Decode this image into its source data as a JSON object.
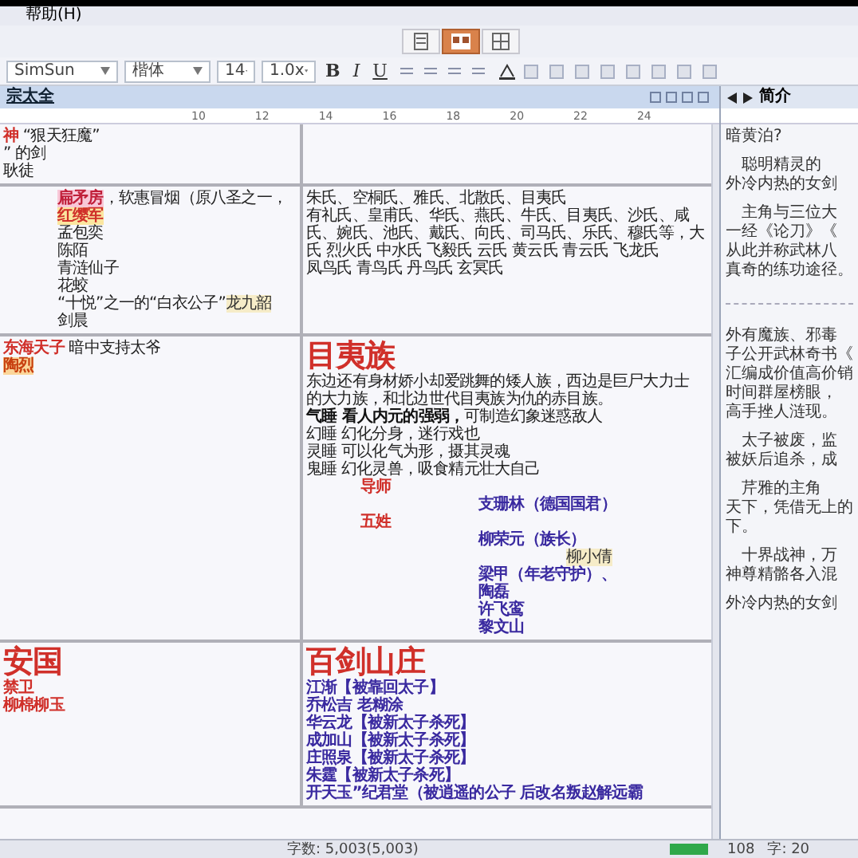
{
  "menu_bar": {
    "items": [
      "帮助(H)"
    ]
  },
  "view_buttons": [
    {
      "selected": false
    },
    {
      "selected": true
    },
    {
      "selected": false
    }
  ],
  "format_toolbar": {
    "font_name": "SimSun",
    "font_family": "楷体",
    "font_size": "14",
    "line_spacing": "1.0x",
    "style_buttons": [
      "B",
      "I",
      "U"
    ]
  },
  "document": {
    "title": "宗太全",
    "ruler_labels": [
      "10",
      "12",
      "14",
      "16",
      "18",
      "20",
      "22",
      "24"
    ],
    "rows": [
      {
        "cells": [
          [
            {
              "kind": "entry",
              "spans": [
                {
                  "text": "神",
                  "kind": "red"
                },
                {
                  "text": "    “狠天狂魔”",
                  "kind": "plain"
                }
              ]
            },
            {
              "kind": "entry",
              "spans": [
                {
                  "text": "”  的剑",
                  "kind": "plain"
                }
              ]
            },
            {
              "kind": "entry",
              "spans": [
                {
                  "text": "  耿徒",
                  "kind": "plain"
                }
              ]
            }
          ],
          []
        ]
      },
      {
        "cells": [
          [
            {
              "kind": "sub",
              "spans": [
                {
                  "text": "扁矛房",
                  "kind": "pink"
                },
                {
                  "text": "，软惠冒烟（原八圣之一，",
                  "kind": "plain"
                }
              ]
            },
            {
              "kind": "sub",
              "spans": [
                {
                  "text": "红缨军",
                  "kind": "yellow"
                }
              ]
            },
            {
              "kind": "sub",
              "spans": [
                {
                  "text": "孟包奕",
                  "kind": "plain"
                }
              ]
            },
            {
              "kind": "sub",
              "spans": [
                {
                  "text": "陈陌",
                  "kind": "plain"
                }
              ]
            },
            {
              "kind": "sub",
              "spans": [
                {
                  "text": "青涟仙子",
                  "kind": "plain"
                }
              ]
            },
            {
              "kind": "sub",
              "spans": [
                {
                  "text": "花蛟",
                  "kind": "plain"
                }
              ]
            },
            {
              "kind": "sub",
              "spans": [
                {
                  "text": "“十悦”之一的“白衣公子”",
                  "kind": "plain"
                },
                {
                  "text": "龙九韶",
                  "kind": "beige"
                }
              ]
            },
            {
              "kind": "sub",
              "spans": [
                {
                  "text": "剑晨",
                  "kind": "plain"
                }
              ]
            }
          ],
          [
            {
              "kind": "entry",
              "spans": [
                {
                  "text": "朱氏、空桐氏、雅氏、北散氏、目夷氏",
                  "kind": "plain"
                }
              ]
            },
            {
              "kind": "entry",
              "spans": [
                {
                  "text": "有礼氏、皇甫氏、华氏、燕氏、牛氏、目夷氏、沙氏、咸",
                  "kind": "plain"
                }
              ]
            },
            {
              "kind": "entry",
              "spans": [
                {
                  "text": "氏、婉氏、池氏、戴氏、向氏、司马氏、乐氏、穆氏等，大",
                  "kind": "plain"
                }
              ]
            },
            {
              "kind": "entry",
              "spans": [
                {
                  "text": "氏 烈火氏 中水氏 飞毅氏 云氏 黄云氏 青云氏 飞龙氏",
                  "kind": "plain"
                }
              ]
            },
            {
              "kind": "entry",
              "spans": [
                {
                  "text": "凤鸟氏 青鸟氏 丹鸟氏 玄冥氏",
                  "kind": "plain"
                }
              ]
            }
          ]
        ]
      },
      {
        "cells": [
          [
            {
              "kind": "entry",
              "spans": [
                {
                  "text": "东海天子",
                  "kind": "red"
                },
                {
                  "text": " 暗中支持太爷",
                  "kind": "plain"
                }
              ]
            },
            {
              "kind": "entry",
              "spans": [
                {
                  "text": "陶烈",
                  "kind": "orange"
                }
              ]
            }
          ],
          [
            {
              "kind": "entry",
              "spans": [
                {
                  "text": "目夷族",
                  "kind": "heading"
                }
              ]
            },
            {
              "kind": "entry",
              "spans": [
                {
                  "text": "东边还有身材娇小却爱跳舞的矮人族，西边是巨尸大力士",
                  "kind": "plain"
                }
              ]
            },
            {
              "kind": "entry",
              "spans": [
                {
                  "text": "的大力族，和北边世代目夷族为仇的赤目族。",
                  "kind": "plain"
                }
              ]
            },
            {
              "kind": "entry",
              "spans": [
                {
                  "text": "气睡 看人内元的强弱，",
                  "kind": "bold"
                },
                {
                  "text": "可制造幻象迷惑敌人",
                  "kind": "plain"
                }
              ]
            },
            {
              "kind": "entry",
              "spans": [
                {
                  "text": "幻睡 幻化分身，迷行戏也",
                  "kind": "plain"
                }
              ]
            },
            {
              "kind": "entry",
              "spans": [
                {
                  "text": "灵睡 可以化气为形，摄其灵魂",
                  "kind": "plain"
                }
              ]
            },
            {
              "kind": "entry",
              "spans": [
                {
                  "text": "鬼睡 幻化灵兽，吸食精元壮大自己",
                  "kind": "plain"
                }
              ]
            },
            {
              "kind": "sub",
              "spans": [
                {
                  "text": "导师",
                  "kind": "red"
                }
              ]
            },
            {
              "kind": "member",
              "spans": [
                {
                  "text": "支珊林（德国国君）",
                  "kind": "blue"
                }
              ]
            },
            {
              "kind": "sub",
              "spans": [
                {
                  "text": "五姓",
                  "kind": "red"
                }
              ]
            },
            {
              "kind": "member",
              "spans": [
                {
                  "text": "柳荣元（族长）",
                  "kind": "blue"
                }
              ]
            },
            {
              "kind": "aside",
              "spans": [
                {
                  "text": "柳小倩",
                  "kind": "beige"
                }
              ]
            },
            {
              "kind": "member",
              "spans": [
                {
                  "text": "梁甲（年老守护）、",
                  "kind": "blue"
                }
              ]
            },
            {
              "kind": "member",
              "spans": [
                {
                  "text": "陶磊",
                  "kind": "blue"
                }
              ]
            },
            {
              "kind": "member",
              "spans": [
                {
                  "text": "许飞鸾",
                  "kind": "blue"
                }
              ]
            },
            {
              "kind": "member",
              "spans": [
                {
                  "text": "黎文山",
                  "kind": "blue"
                }
              ]
            }
          ]
        ]
      },
      {
        "cells": [
          [
            {
              "kind": "entry",
              "spans": [
                {
                  "text": "安国",
                  "kind": "heading"
                }
              ]
            },
            {
              "kind": "entry",
              "spans": [
                {
                  "text": "禁卫",
                  "kind": "red"
                }
              ]
            },
            {
              "kind": "entry",
              "spans": [
                {
                  "text": "柳棉柳玉",
                  "kind": "red"
                }
              ]
            }
          ],
          [
            {
              "kind": "entry",
              "spans": [
                {
                  "text": "百剑山庄",
                  "kind": "heading"
                }
              ]
            },
            {
              "kind": "entry",
              "spans": [
                {
                  "text": "江渐【被靠回太子】",
                  "kind": "blue"
                }
              ]
            },
            {
              "kind": "entry",
              "spans": [
                {
                  "text": "乔松吉 老糊涂",
                  "kind": "blue"
                }
              ]
            },
            {
              "kind": "entry",
              "spans": [
                {
                  "text": "华云龙【被新太子杀死】",
                  "kind": "blue"
                }
              ]
            },
            {
              "kind": "entry",
              "spans": [
                {
                  "text": "成加山【被新太子杀死】",
                  "kind": "blue"
                }
              ]
            },
            {
              "kind": "entry",
              "spans": [
                {
                  "text": "庄照泉【被新太子杀死】",
                  "kind": "blue"
                }
              ]
            },
            {
              "kind": "entry",
              "spans": [
                {
                  "text": "朱霆【被新太子杀死】",
                  "kind": "blue"
                }
              ]
            },
            {
              "kind": "entry",
              "spans": [
                {
                  "text": "开天玉”纪君堂（被逍遥的公子 后改名叛赵解远霸",
                  "kind": "blue"
                }
              ]
            }
          ]
        ]
      }
    ]
  },
  "side_panel": {
    "title": "简介",
    "lines": [
      {
        "kind": "text",
        "text": "暗黄泊?"
      },
      {
        "kind": "gap"
      },
      {
        "kind": "text",
        "text": "　聪明精灵的"
      },
      {
        "kind": "text",
        "text": "外冷内热的女剑"
      },
      {
        "kind": "gap"
      },
      {
        "kind": "text",
        "text": "　主角与三位大"
      },
      {
        "kind": "text",
        "text": "一经《论刀》《"
      },
      {
        "kind": "text",
        "text": "从此并称武林八"
      },
      {
        "kind": "text",
        "text": "真奇的练功途径。"
      },
      {
        "kind": "rule"
      },
      {
        "kind": "text",
        "text": "外有魔族、邪毒"
      },
      {
        "kind": "text",
        "text": "子公开武林奇书《"
      },
      {
        "kind": "text",
        "text": "汇编成价值高价销"
      },
      {
        "kind": "text",
        "text": "时间群屋榜眼，"
      },
      {
        "kind": "text",
        "text": "高手挫人涟现。"
      },
      {
        "kind": "gap"
      },
      {
        "kind": "text",
        "text": "　太子被废，监"
      },
      {
        "kind": "text",
        "text": "被妖后追杀，成"
      },
      {
        "kind": "gap"
      },
      {
        "kind": "text",
        "text": "　芹雅的主角"
      },
      {
        "kind": "text",
        "text": "天下，凭借无上的"
      },
      {
        "kind": "text",
        "text": "下。"
      },
      {
        "kind": "gap"
      },
      {
        "kind": "text",
        "text": "　十界战神，万"
      },
      {
        "kind": "text",
        "text": "神尊精骼各入混"
      },
      {
        "kind": "gap"
      },
      {
        "kind": "text",
        "text": "外冷内热的女剑"
      }
    ],
    "status": [
      "108",
      "字: 20"
    ]
  },
  "status_bar": {
    "word_count": "字数: 5,003(5,003)"
  }
}
